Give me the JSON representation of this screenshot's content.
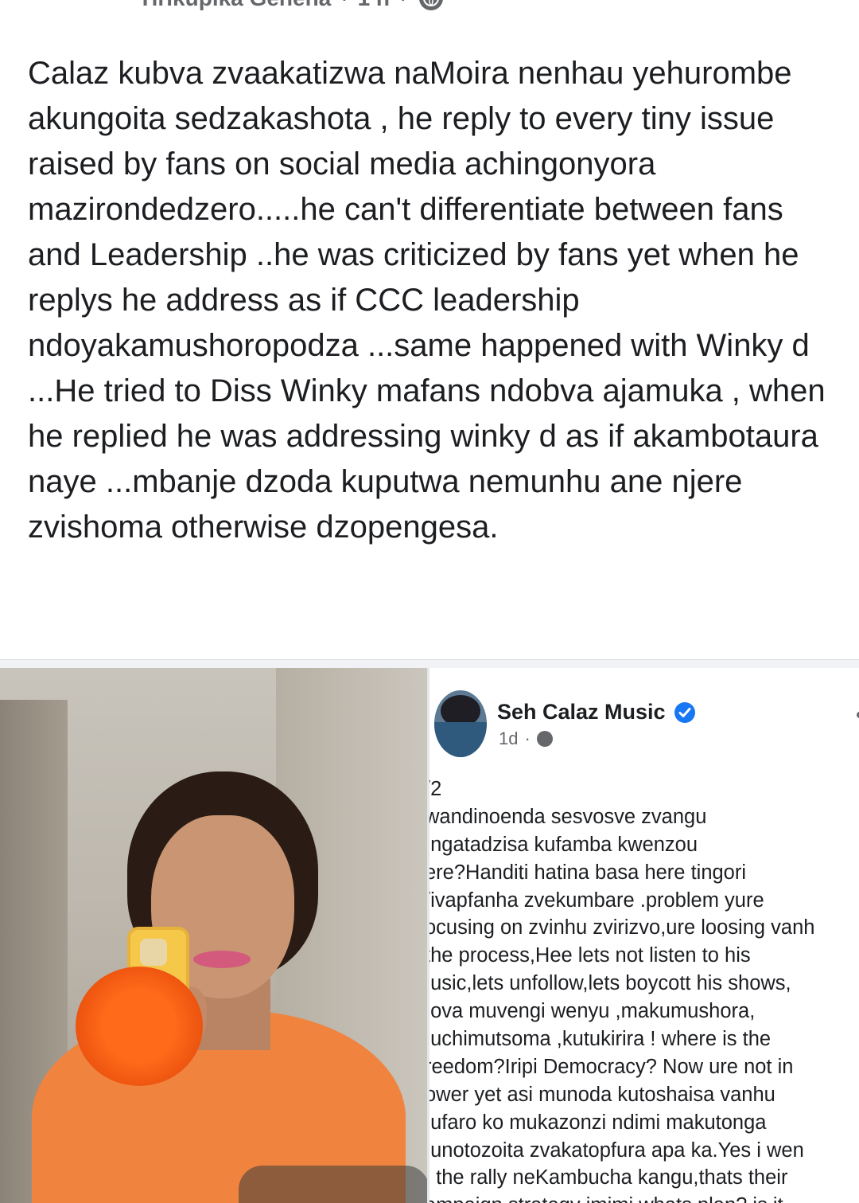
{
  "post": {
    "author": "Tirikupika Gehena",
    "time": "1 h",
    "text": "Calaz kubva zvaakatizwa naMoira nenhau yehurombe akungoita sedzakashota , he reply  to every tiny issue raised by fans on social media achingonyora mazirondedzero.....he can't differentiate between fans and Leadership ..he was criticized by fans yet when he  replys he address  as if CCC leadership ndoyakamushoropodza ...same happened with Winky d ...He tried to Diss Winky mafans ndobva ajamuka , when he replied he was addressing winky d as if akambotaura naye ...mbanje dzoda kuputwa nemunhu ane njere zvishoma otherwise dzopengesa."
  },
  "photo": {
    "label": "woman in orange top holding phone"
  },
  "shared_post": {
    "page_name": "Seh Calaz Music",
    "time": "1d",
    "lines": [
      "/2",
      "wandinoenda sesvosve zvangu",
      "ıngatadzisa kufamba kwenzou",
      "ere?Handiti hatina basa here tingori",
      "/ivapfanha zvekumbare .problem yure",
      "ocusing on zvinhu zvirizvo,ure loosing vanh",
      " the process,Hee lets not listen to his",
      "ıusic,lets unfollow,lets boycott his shows,",
      ":ova muvengi wenyu ,makumushora,",
      "ıuchimutsoma ,kutukirira ! where is the",
      "reedom?Iripi Democracy? Now ure not in",
      "ower yet asi munoda kutoshaisa vanhu",
      "ıufaro ko mukazonzi ndimi makutonga",
      "ıunotozoita zvakatopfura apa ka.Yes i wen",
      "ı the rally neKambucha kangu,thats their",
      "ampaign strategy imimi whats plan? is it"
    ]
  },
  "colors": {
    "text": "#1c1e21",
    "meta": "#65676b",
    "verified": "#1877f2"
  }
}
